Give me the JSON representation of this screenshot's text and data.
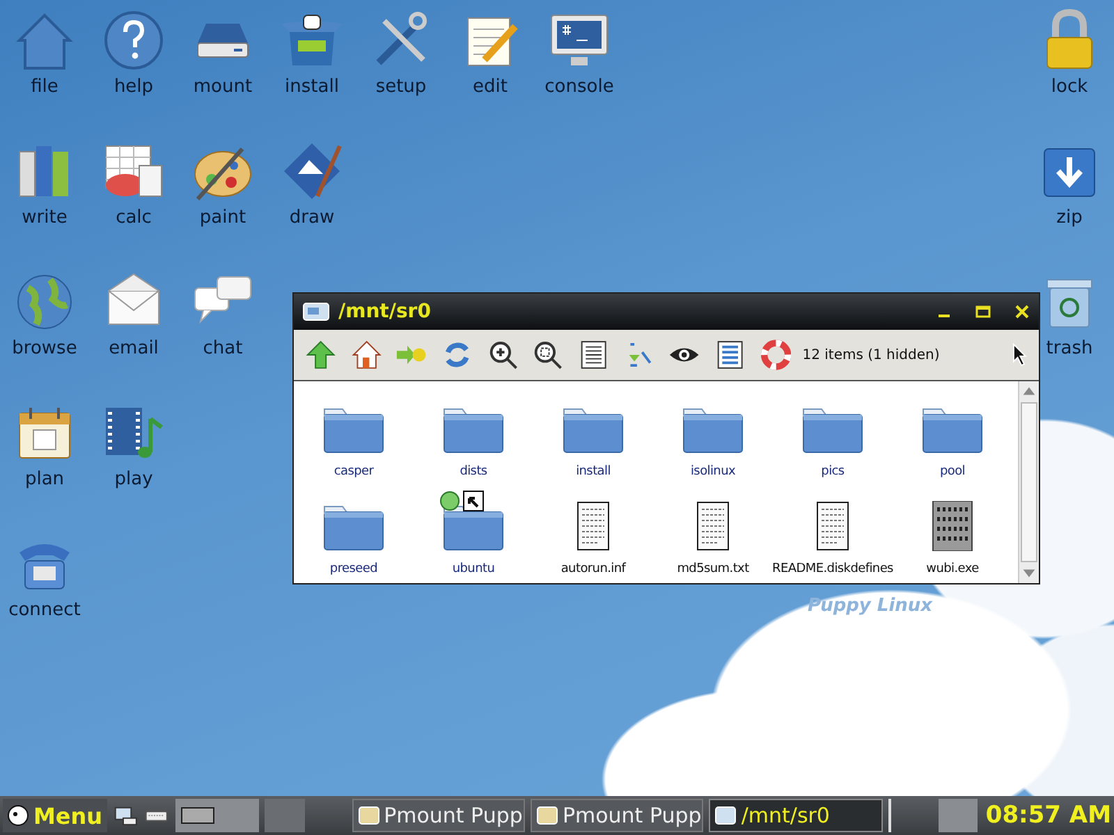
{
  "desktop": {
    "left_rows": [
      [
        {
          "label": "file"
        },
        {
          "label": "help"
        },
        {
          "label": "mount"
        },
        {
          "label": "install"
        },
        {
          "label": "setup"
        },
        {
          "label": "edit"
        },
        {
          "label": "console"
        }
      ],
      [
        {
          "label": "write"
        },
        {
          "label": "calc"
        },
        {
          "label": "paint"
        },
        {
          "label": "draw"
        }
      ],
      [
        {
          "label": "browse"
        },
        {
          "label": "email"
        },
        {
          "label": "chat"
        }
      ],
      [
        {
          "label": "plan"
        },
        {
          "label": "play"
        }
      ],
      [
        {
          "label": "connect"
        }
      ]
    ],
    "right_column": [
      {
        "label": "lock"
      },
      {
        "label": "zip"
      },
      {
        "label": "trash"
      }
    ],
    "wallpaper_text": "Puppy Linux"
  },
  "window": {
    "title": "/mnt/sr0",
    "status": "12 items (1 hidden)",
    "files": [
      {
        "name": "casper",
        "kind": "folder",
        "linked": false
      },
      {
        "name": "dists",
        "kind": "folder",
        "linked": false
      },
      {
        "name": "install",
        "kind": "folder",
        "linked": false
      },
      {
        "name": "isolinux",
        "kind": "folder",
        "linked": false
      },
      {
        "name": "pics",
        "kind": "folder",
        "linked": false
      },
      {
        "name": "pool",
        "kind": "folder",
        "linked": false
      },
      {
        "name": "preseed",
        "kind": "folder",
        "linked": false
      },
      {
        "name": "ubuntu",
        "kind": "folder",
        "linked": true
      },
      {
        "name": "autorun.inf",
        "kind": "document",
        "linked": false
      },
      {
        "name": "md5sum.txt",
        "kind": "document",
        "linked": false
      },
      {
        "name": "README.diskdefines",
        "kind": "document",
        "linked": false
      },
      {
        "name": "wubi.exe",
        "kind": "binary",
        "linked": false
      }
    ]
  },
  "taskbar": {
    "menu": "Menu",
    "tasks": [
      {
        "label": "Pmount Pupp",
        "selected": false
      },
      {
        "label": "Pmount Pupp",
        "selected": false
      },
      {
        "label": "/mnt/sr0",
        "selected": true
      }
    ],
    "clock": "08:57 AM"
  }
}
